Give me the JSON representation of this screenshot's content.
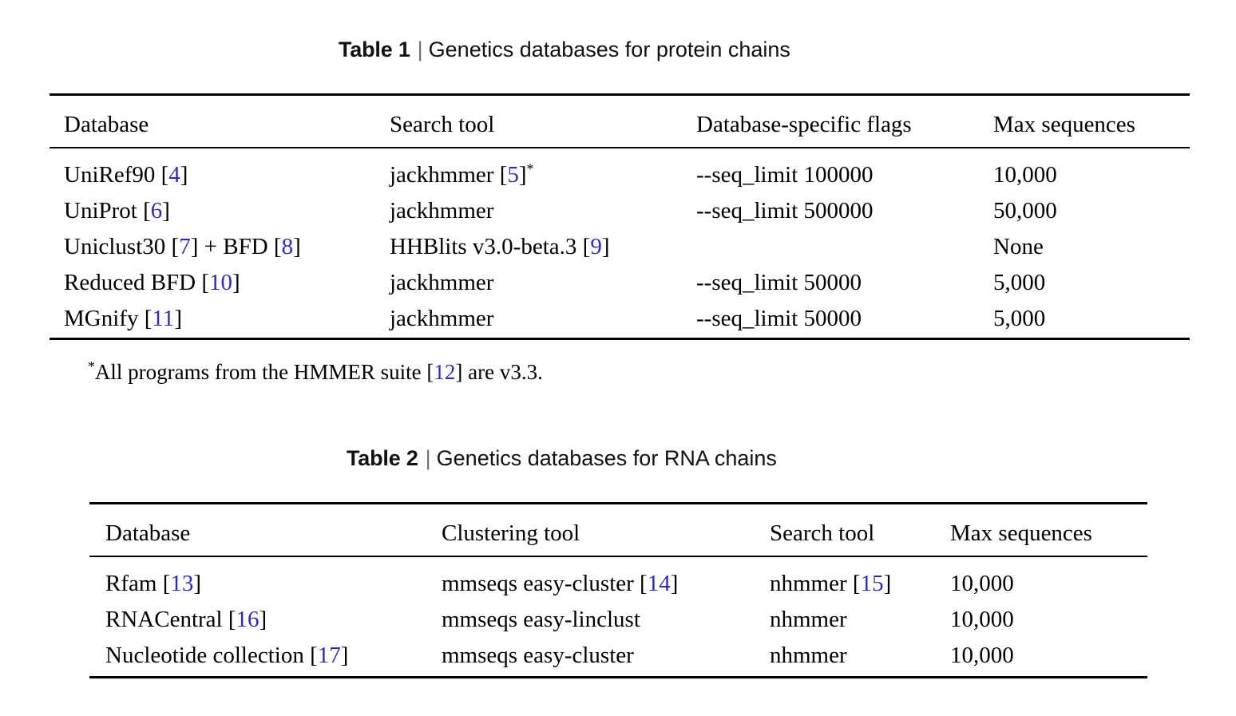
{
  "table1": {
    "caption": {
      "label": "Table 1",
      "separator": "|",
      "text": "Genetics databases for protein chains"
    },
    "columns": [
      "Database",
      "Search tool",
      "Database-specific flags",
      "Max sequences"
    ],
    "rows": [
      {
        "database": "UniRef90",
        "database_cite": "4",
        "search_tool": "jackhmmer",
        "search_tool_cite": "5",
        "search_tool_star": "*",
        "flags": "--seq_limit 100000",
        "max_sequences": "10,000"
      },
      {
        "database": "UniProt",
        "database_cite": "6",
        "search_tool": "jackhmmer",
        "search_tool_cite": "",
        "search_tool_star": "",
        "flags": "--seq_limit 500000",
        "max_sequences": "50,000"
      },
      {
        "database": "Uniclust30",
        "database_cite": "7",
        "database_extra": "+ BFD",
        "database_extra_cite": "8",
        "search_tool": "HHBlits v3.0-beta.3",
        "search_tool_cite": "9",
        "search_tool_star": "",
        "flags": "",
        "max_sequences": "None"
      },
      {
        "database": "Reduced BFD",
        "database_cite": "10",
        "search_tool": "jackhmmer",
        "search_tool_cite": "",
        "search_tool_star": "",
        "flags": "--seq_limit 50000",
        "max_sequences": "5,000"
      },
      {
        "database": "MGnify",
        "database_cite": "11",
        "search_tool": "jackhmmer",
        "search_tool_cite": "",
        "search_tool_star": "",
        "flags": "--seq_limit 50000",
        "max_sequences": "5,000"
      }
    ],
    "footnote": {
      "star": "*",
      "text_before": "All programs from the HMMER suite ",
      "cite": "12",
      "text_after": " are v3.3."
    }
  },
  "table2": {
    "caption": {
      "label": "Table 2",
      "separator": "|",
      "text": "Genetics databases for RNA chains"
    },
    "columns": [
      "Database",
      "Clustering tool",
      "Search tool",
      "Max sequences"
    ],
    "rows": [
      {
        "database": "Rfam",
        "database_cite": "13",
        "clustering_tool": "mmseqs easy-cluster",
        "clustering_tool_cite": "14",
        "search_tool": "nhmmer",
        "search_tool_cite": "15",
        "max_sequences": "10,000"
      },
      {
        "database": "RNACentral",
        "database_cite": "16",
        "clustering_tool": "mmseqs easy-linclust",
        "clustering_tool_cite": "",
        "search_tool": "nhmmer",
        "search_tool_cite": "",
        "max_sequences": "10,000"
      },
      {
        "database": "Nucleotide collection",
        "database_cite": "17",
        "clustering_tool": "mmseqs easy-cluster",
        "clustering_tool_cite": "",
        "search_tool": "nhmmer",
        "search_tool_cite": "",
        "max_sequences": "10,000"
      }
    ]
  },
  "colors": {
    "citation": "#2b2bbd",
    "rule": "#000000",
    "text": "#000000"
  }
}
